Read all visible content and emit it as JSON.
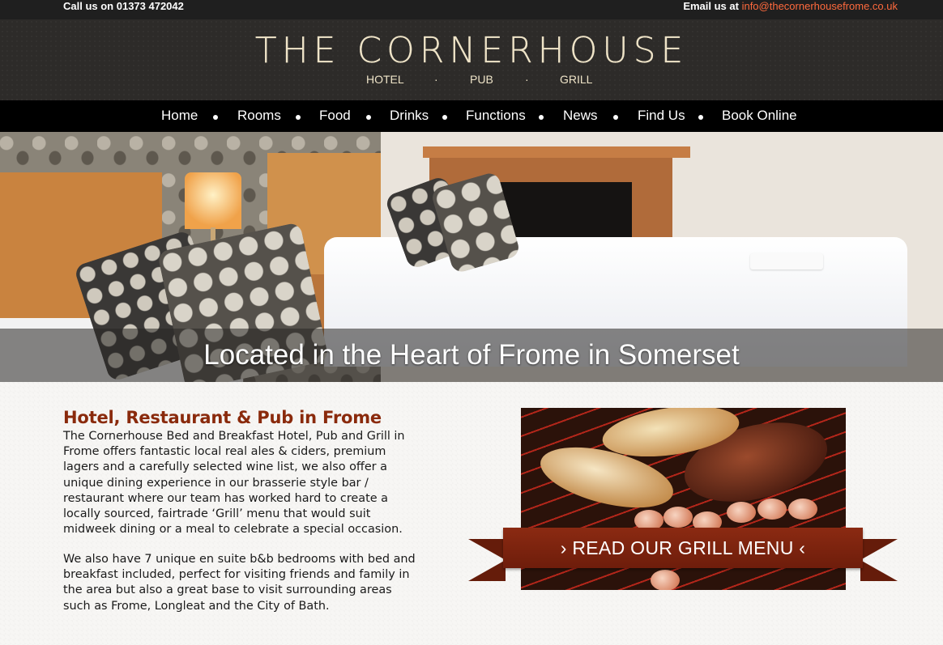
{
  "topbar": {
    "call_label": "Call us on 01373 472042",
    "email_prefix": "Email us at",
    "email_link": "info@thecornerhousefrome.co.uk"
  },
  "header": {
    "title": "THE CORNERHOUSE",
    "subtitle": [
      "HOTEL",
      "·",
      "PUB",
      "·",
      "GRILL"
    ]
  },
  "nav": {
    "items": [
      "Home",
      "Rooms",
      "Food",
      "Drinks",
      "Functions",
      "News",
      "Find Us",
      "Book Online"
    ]
  },
  "hero": {
    "caption": "Located in the Heart of Frome in Somerset"
  },
  "content": {
    "title": "Hotel, Restaurant & Pub in Frome",
    "para1": "The Cornerhouse Bed and Breakfast Hotel, Pub and Grill in Frome offers fantastic local real ales & ciders, premium lagers and a carefully selected wine list, we also offer a unique dining experience in our brasserie style bar / restaurant where our team has worked hard to create a locally sourced, fairtrade ‘Grill’ menu that would suit midweek dining or a meal to celebrate a special occasion.",
    "para2": "We also have 7 unique en suite b&b bedrooms with bed and breakfast included, perfect for visiting friends and family in the area but also a great base to visit surrounding areas such as Frome, Longleat and the City of Bath."
  },
  "promo": {
    "ribbon_label": "› READ OUR GRILL MENU ‹",
    "ribbon_color": "#7a220d"
  },
  "colors": {
    "accent": "#8a2a0c",
    "email_link": "#ff6a3d",
    "header_text": "#efe4c8"
  }
}
